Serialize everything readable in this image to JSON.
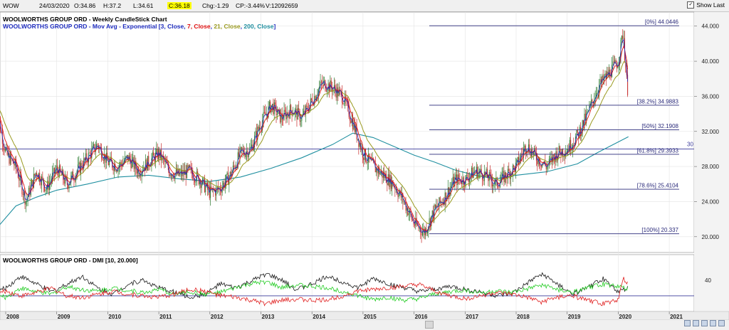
{
  "header": {
    "symbol": "WOW",
    "date": "24/03/2020",
    "open": "O:34.86",
    "high": "H:37.2",
    "low": "L:34.61",
    "close": "C:36.18",
    "change": "Chg:-1.29",
    "change_pct": "CP:-3.44%",
    "volume": "V:12092659",
    "show_last_label": "Show Last",
    "show_last_checked": "✓"
  },
  "chart_data": [
    {
      "type": "candlestick",
      "title": "WOOLWORTHS GROUP ORD - Weekly CandleStick Chart",
      "overlay_prefix": "WOOLWORTHS GROUP ORD - Mov Avg - Exponential [",
      "overlay_parts": [
        {
          "text": "3, Close",
          "color": "#1f2dbf"
        },
        {
          "text": "7, Close",
          "color": "#e01010"
        },
        {
          "text": "21, Close",
          "color": "#9a9a20"
        },
        {
          "text": "200, Close",
          "color": "#1f8fa0"
        }
      ],
      "ylim": [
        18.2,
        45.6
      ],
      "y_ticks": [
        "44.000",
        "40.000",
        "36.000",
        "32.000",
        "28.000",
        "24.000",
        "20.000"
      ],
      "x_ticks": [
        "2008",
        "2009",
        "2010",
        "2011",
        "2012",
        "2013",
        "2014",
        "2015",
        "2016",
        "2017",
        "2018",
        "2019",
        "2020",
        "2021"
      ],
      "price_path": [
        [
          2007.8,
          35.0
        ],
        [
          2008.0,
          29.5
        ],
        [
          2008.2,
          28.0
        ],
        [
          2008.4,
          24.0
        ],
        [
          2008.6,
          27.5
        ],
        [
          2008.8,
          25.5
        ],
        [
          2009.0,
          27.8
        ],
        [
          2009.2,
          26.0
        ],
        [
          2009.4,
          27.5
        ],
        [
          2009.6,
          29.0
        ],
        [
          2009.8,
          30.5
        ],
        [
          2010.0,
          28.5
        ],
        [
          2010.2,
          28.0
        ],
        [
          2010.4,
          29.0
        ],
        [
          2010.6,
          27.5
        ],
        [
          2010.8,
          28.5
        ],
        [
          2011.0,
          29.5
        ],
        [
          2011.2,
          27.5
        ],
        [
          2011.4,
          27.0
        ],
        [
          2011.6,
          27.5
        ],
        [
          2011.8,
          26.5
        ],
        [
          2012.0,
          25.0
        ],
        [
          2012.2,
          25.5
        ],
        [
          2012.4,
          27.0
        ],
        [
          2012.6,
          29.5
        ],
        [
          2012.8,
          30.0
        ],
        [
          2013.0,
          33.0
        ],
        [
          2013.2,
          35.0
        ],
        [
          2013.4,
          33.5
        ],
        [
          2013.6,
          34.5
        ],
        [
          2013.8,
          33.5
        ],
        [
          2014.0,
          35.5
        ],
        [
          2014.2,
          37.5
        ],
        [
          2014.4,
          37.0
        ],
        [
          2014.6,
          36.0
        ],
        [
          2014.8,
          33.0
        ],
        [
          2015.0,
          29.5
        ],
        [
          2015.2,
          28.0
        ],
        [
          2015.4,
          27.0
        ],
        [
          2015.6,
          26.0
        ],
        [
          2015.8,
          24.0
        ],
        [
          2016.0,
          21.5
        ],
        [
          2016.2,
          20.5
        ],
        [
          2016.4,
          23.0
        ],
        [
          2016.6,
          24.5
        ],
        [
          2016.8,
          26.5
        ],
        [
          2017.0,
          26.5
        ],
        [
          2017.2,
          27.5
        ],
        [
          2017.4,
          27.0
        ],
        [
          2017.6,
          26.0
        ],
        [
          2017.8,
          27.0
        ],
        [
          2018.0,
          28.0
        ],
        [
          2018.2,
          30.5
        ],
        [
          2018.4,
          29.0
        ],
        [
          2018.6,
          28.0
        ],
        [
          2018.8,
          29.5
        ],
        [
          2019.0,
          30.0
        ],
        [
          2019.2,
          31.5
        ],
        [
          2019.4,
          34.0
        ],
        [
          2019.6,
          37.0
        ],
        [
          2019.8,
          38.5
        ],
        [
          2020.0,
          40.0
        ],
        [
          2020.1,
          43.5
        ],
        [
          2020.15,
          38.5
        ],
        [
          2020.2,
          36.18
        ]
      ],
      "ema200_path": [
        [
          2007.8,
          20.8
        ],
        [
          2008.2,
          23.5
        ],
        [
          2008.6,
          24.5
        ],
        [
          2009.0,
          25.3
        ],
        [
          2009.6,
          26.0
        ],
        [
          2010.2,
          26.8
        ],
        [
          2010.8,
          27.0
        ],
        [
          2011.4,
          26.6
        ],
        [
          2012.0,
          26.3
        ],
        [
          2012.6,
          26.8
        ],
        [
          2013.2,
          27.8
        ],
        [
          2013.8,
          29.0
        ],
        [
          2014.4,
          30.5
        ],
        [
          2014.8,
          31.8
        ],
        [
          2015.2,
          31.3
        ],
        [
          2015.6,
          30.3
        ],
        [
          2016.0,
          29.3
        ],
        [
          2016.4,
          28.5
        ],
        [
          2016.8,
          27.6
        ],
        [
          2017.2,
          27.0
        ],
        [
          2017.6,
          26.6
        ],
        [
          2018.0,
          27.0
        ],
        [
          2018.6,
          27.4
        ],
        [
          2019.2,
          28.3
        ],
        [
          2019.6,
          29.6
        ],
        [
          2020.0,
          30.8
        ],
        [
          2020.2,
          31.4
        ]
      ],
      "fib_levels": [
        {
          "label": "[0%] 44.0446",
          "value": 44.0446
        },
        {
          "label": "[38.2%] 34.9883",
          "value": 34.9883
        },
        {
          "label": "[50%] 32.1908",
          "value": 32.1908
        },
        {
          "label": "[61.8%] 29.3933",
          "value": 29.3933
        },
        {
          "label": "[78.6%] 25.4104",
          "value": 25.4104
        },
        {
          "label": "[100%] 20.337",
          "value": 20.337
        }
      ],
      "horizontal_line": {
        "value": 30.0,
        "label": "30"
      }
    },
    {
      "type": "line",
      "title": "WOOLWORTHS GROUP ORD - DMI [10, 20.000]",
      "ylim": [
        0,
        58
      ],
      "y_ticks": [
        "40"
      ],
      "reference_line": 20,
      "series": [
        {
          "color": "#1a1a1a",
          "values": [
            [
              2007.8,
              25
            ],
            [
              2008.0,
              30
            ],
            [
              2008.3,
              45
            ],
            [
              2008.6,
              35
            ],
            [
              2008.9,
              25
            ],
            [
              2009.2,
              35
            ],
            [
              2009.5,
              45
            ],
            [
              2009.8,
              30
            ],
            [
              2010.1,
              22
            ],
            [
              2010.4,
              35
            ],
            [
              2010.7,
              40
            ],
            [
              2011.0,
              30
            ],
            [
              2011.3,
              25
            ],
            [
              2011.6,
              18
            ],
            [
              2011.9,
              22
            ],
            [
              2012.2,
              35
            ],
            [
              2012.5,
              30
            ],
            [
              2012.8,
              38
            ],
            [
              2013.1,
              48
            ],
            [
              2013.4,
              40
            ],
            [
              2013.7,
              28
            ],
            [
              2014.0,
              35
            ],
            [
              2014.3,
              45
            ],
            [
              2014.6,
              38
            ],
            [
              2014.9,
              30
            ],
            [
              2015.2,
              42
            ],
            [
              2015.5,
              35
            ],
            [
              2015.8,
              30
            ],
            [
              2016.1,
              25
            ],
            [
              2016.4,
              28
            ],
            [
              2016.7,
              32
            ],
            [
              2017.0,
              28
            ],
            [
              2017.3,
              25
            ],
            [
              2017.6,
              20
            ],
            [
              2017.9,
              22
            ],
            [
              2018.2,
              35
            ],
            [
              2018.5,
              48
            ],
            [
              2018.8,
              35
            ],
            [
              2019.1,
              22
            ],
            [
              2019.4,
              30
            ],
            [
              2019.7,
              42
            ],
            [
              2020.0,
              25
            ],
            [
              2020.2,
              30
            ]
          ]
        },
        {
          "color": "#22cc22",
          "values": [
            [
              2007.8,
              20
            ],
            [
              2008.0,
              18
            ],
            [
              2008.3,
              30
            ],
            [
              2008.6,
              25
            ],
            [
              2008.9,
              22
            ],
            [
              2009.2,
              32
            ],
            [
              2009.5,
              28
            ],
            [
              2009.8,
              26
            ],
            [
              2010.1,
              30
            ],
            [
              2010.4,
              27
            ],
            [
              2010.7,
              24
            ],
            [
              2011.0,
              28
            ],
            [
              2011.3,
              22
            ],
            [
              2011.6,
              25
            ],
            [
              2011.9,
              22
            ],
            [
              2012.2,
              24
            ],
            [
              2012.5,
              30
            ],
            [
              2012.8,
              35
            ],
            [
              2013.1,
              38
            ],
            [
              2013.4,
              30
            ],
            [
              2013.7,
              34
            ],
            [
              2014.0,
              32
            ],
            [
              2014.3,
              30
            ],
            [
              2014.6,
              26
            ],
            [
              2014.9,
              20
            ],
            [
              2015.2,
              15
            ],
            [
              2015.5,
              18
            ],
            [
              2015.8,
              14
            ],
            [
              2016.1,
              16
            ],
            [
              2016.4,
              22
            ],
            [
              2016.7,
              25
            ],
            [
              2017.0,
              27
            ],
            [
              2017.3,
              24
            ],
            [
              2017.6,
              26
            ],
            [
              2017.9,
              24
            ],
            [
              2018.2,
              28
            ],
            [
              2018.5,
              34
            ],
            [
              2018.8,
              28
            ],
            [
              2019.1,
              24
            ],
            [
              2019.4,
              30
            ],
            [
              2019.7,
              35
            ],
            [
              2020.0,
              32
            ],
            [
              2020.2,
              28
            ]
          ]
        },
        {
          "color": "#e02020",
          "values": [
            [
              2007.8,
              22
            ],
            [
              2008.0,
              26
            ],
            [
              2008.3,
              20
            ],
            [
              2008.6,
              24
            ],
            [
              2008.9,
              30
            ],
            [
              2009.2,
              20
            ],
            [
              2009.5,
              18
            ],
            [
              2009.8,
              22
            ],
            [
              2010.1,
              26
            ],
            [
              2010.4,
              22
            ],
            [
              2010.7,
              20
            ],
            [
              2011.0,
              18
            ],
            [
              2011.3,
              22
            ],
            [
              2011.6,
              28
            ],
            [
              2011.9,
              26
            ],
            [
              2012.2,
              20
            ],
            [
              2012.5,
              18
            ],
            [
              2012.8,
              14
            ],
            [
              2013.1,
              10
            ],
            [
              2013.4,
              14
            ],
            [
              2013.7,
              16
            ],
            [
              2014.0,
              14
            ],
            [
              2014.3,
              15
            ],
            [
              2014.6,
              20
            ],
            [
              2014.9,
              26
            ],
            [
              2015.2,
              28
            ],
            [
              2015.5,
              30
            ],
            [
              2015.8,
              32
            ],
            [
              2016.1,
              34
            ],
            [
              2016.4,
              26
            ],
            [
              2016.7,
              20
            ],
            [
              2017.0,
              16
            ],
            [
              2017.3,
              20
            ],
            [
              2017.6,
              24
            ],
            [
              2017.9,
              22
            ],
            [
              2018.2,
              18
            ],
            [
              2018.5,
              12
            ],
            [
              2018.8,
              18
            ],
            [
              2019.1,
              20
            ],
            [
              2019.4,
              14
            ],
            [
              2019.7,
              10
            ],
            [
              2020.0,
              15
            ],
            [
              2020.1,
              42
            ],
            [
              2020.2,
              34
            ]
          ]
        }
      ]
    }
  ]
}
